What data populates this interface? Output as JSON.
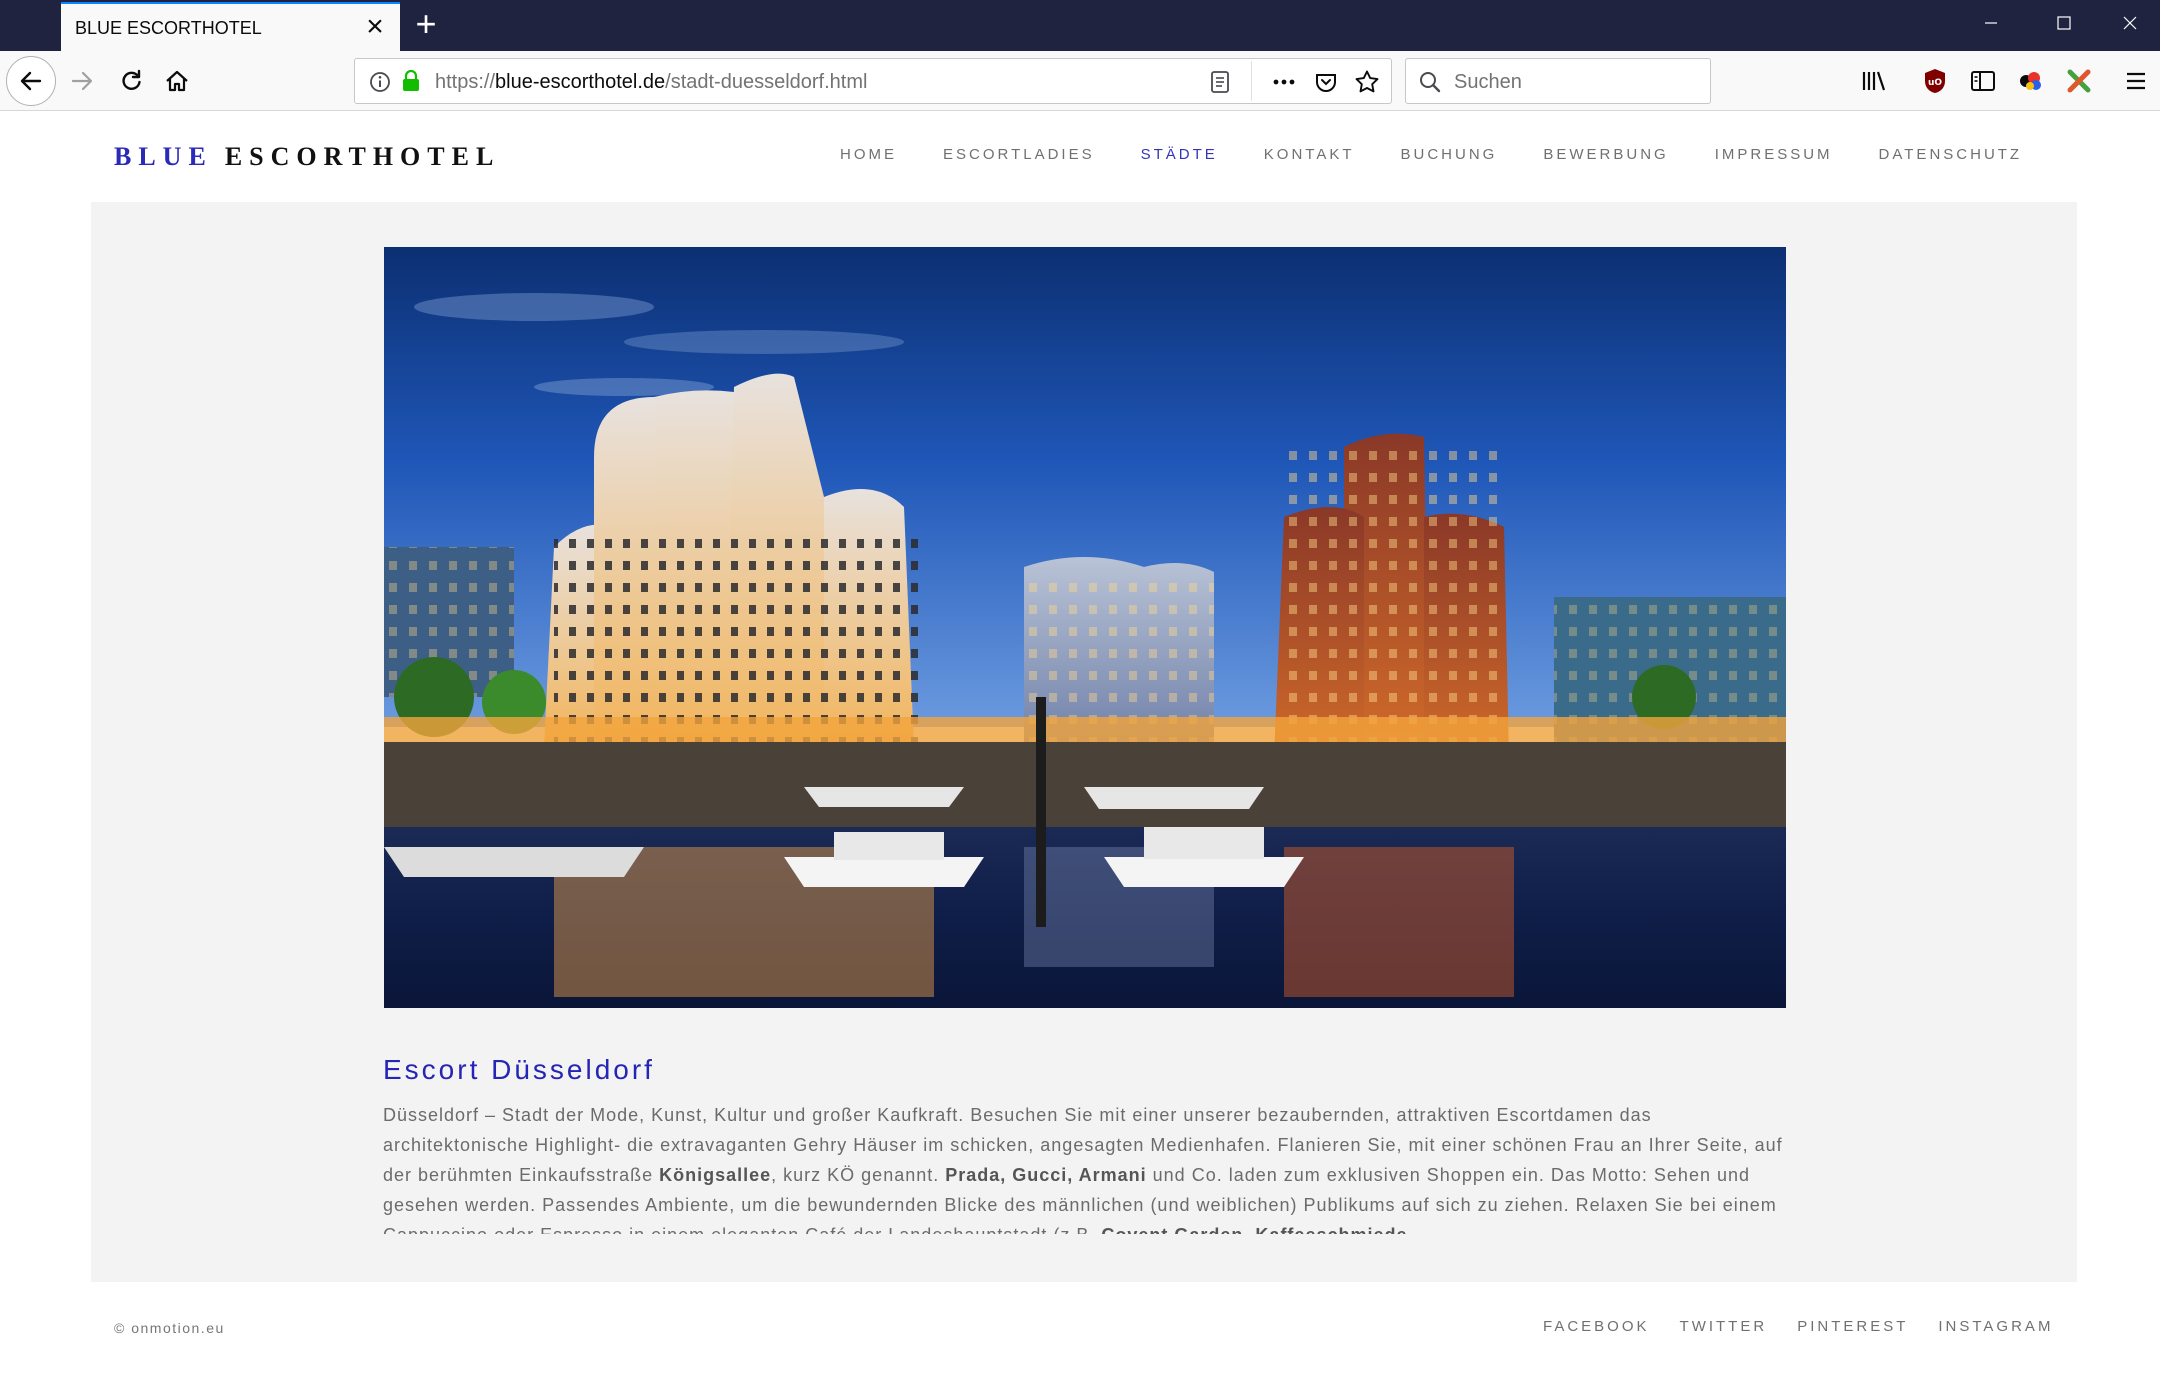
{
  "browser": {
    "tab_title": "BLUE ESCORTHOTEL",
    "url_prefix": "https://",
    "url_host": "blue-escorthotel.de",
    "url_path": "/stadt-duesseldorf.html",
    "search_placeholder": "Suchen"
  },
  "site": {
    "logo_blue": "BLUE",
    "logo_rest": "ESCORTHOTEL",
    "nav": [
      "HOME",
      "ESCORTLADIES",
      "STÄDTE",
      "KONTAKT",
      "BUCHUNG",
      "BEWERBUNG",
      "IMPRESSUM",
      "DATENSCHUTZ"
    ],
    "active_nav": "STÄDTE"
  },
  "article": {
    "heading": "Escort Düsseldorf",
    "p1": "Düsseldorf – Stadt der Mode, Kunst, Kultur und großer Kaufkraft. Besuchen Sie mit einer unserer bezaubernden, attraktiven Escortdamen das architektonische Highlight- die extravaganten Gehry Häuser im schicken, angesagten Medienhafen. Flanieren Sie, mit einer schönen Frau an Ihrer Seite, auf der berühmten Einkaufsstraße ",
    "b1": "Königsallee",
    "p2": ", kurz KÖ genannt. ",
    "b2": "Prada, Gucci, Armani",
    "p3": " und Co. laden zum exklusiven Shoppen ein. Das Motto: Sehen und gesehen werden. Passendes Ambiente, um die bewundernden Blicke des männlichen (und weiblichen) Publikums auf sich zu ziehen. Relaxen Sie bei einem Cappuccino oder Espresso in einem eleganten Café der Landeshauptstadt (z.B. ",
    "b3": "Covent Garden, Kaffeeschmiede"
  },
  "footer": {
    "copyright": "© onmotion.eu",
    "links": [
      "FACEBOOK",
      "TWITTER",
      "PINTEREST",
      "INSTAGRAM"
    ]
  },
  "colors": {
    "accent": "#2424b6",
    "tabstrip": "#202340",
    "panel": "#f3f3f4"
  }
}
